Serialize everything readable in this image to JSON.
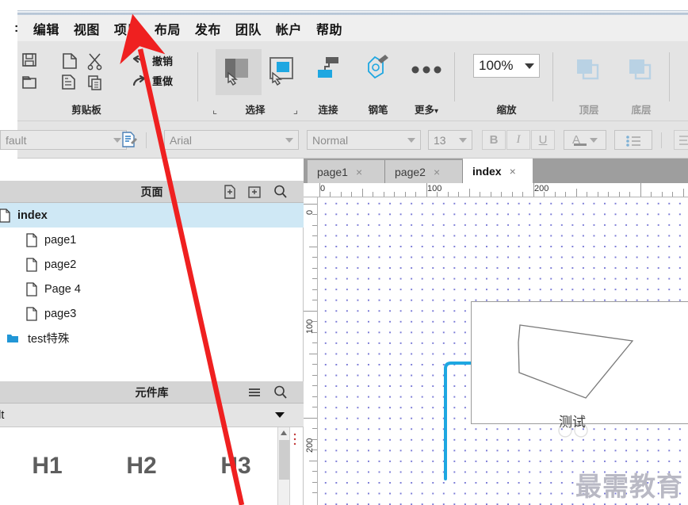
{
  "app": {
    "name": "Axure RP",
    "accent": "#1ea7e1",
    "annotation_color": "#ef2020"
  },
  "menubar": {
    "items": [
      {
        "label": ":",
        "name": "menu-file-clipped"
      },
      {
        "label": "编辑",
        "name": "menu-edit"
      },
      {
        "label": "视图",
        "name": "menu-view"
      },
      {
        "label": "项目",
        "name": "menu-project"
      },
      {
        "label": "布局",
        "name": "menu-layout"
      },
      {
        "label": "发布",
        "name": "menu-publish"
      },
      {
        "label": "团队",
        "name": "menu-team"
      },
      {
        "label": "帐户",
        "name": "menu-account"
      },
      {
        "label": "帮助",
        "name": "menu-help"
      }
    ]
  },
  "ribbon": {
    "clipboard_label": "剪贴板",
    "undo_label": "撤销",
    "redo_label": "重做",
    "select_label": "选择",
    "connect_label": "连接",
    "pen_label": "钢笔",
    "more_label": "更多",
    "more_caret": "▾",
    "zoom_label": "缩放",
    "zoom_value": "100%",
    "front_label": "顶层",
    "back_label": "底层"
  },
  "stylebar": {
    "style_value": "fault",
    "font_value": "Arial",
    "weight_value": "Normal",
    "size_value": "13",
    "bold_label": "B",
    "italic_label": "I",
    "underline_label": "U",
    "color_label": "A",
    "list_label": "≔"
  },
  "pages_panel": {
    "title": "页面",
    "add_page_icon": "add-page-icon",
    "add_folder_icon": "add-folder-icon",
    "search_icon": "search-icon",
    "items": [
      {
        "label": "index",
        "type": "page",
        "indent": 0,
        "selected": true
      },
      {
        "label": "page1",
        "type": "page",
        "indent": 1,
        "selected": false
      },
      {
        "label": "page2",
        "type": "page",
        "indent": 1,
        "selected": false
      },
      {
        "label": "Page 4",
        "type": "page",
        "indent": 1,
        "selected": false
      },
      {
        "label": "page3",
        "type": "page",
        "indent": 1,
        "selected": false
      },
      {
        "label": "test特殊",
        "type": "folder",
        "indent": 0,
        "selected": false
      }
    ]
  },
  "widgets_panel": {
    "title": "元件库",
    "menu_icon": "hamburger-icon",
    "search_icon": "search-icon",
    "library_value": "fault",
    "items": [
      {
        "label": "H1"
      },
      {
        "label": "H2"
      },
      {
        "label": "H3"
      }
    ]
  },
  "canvas": {
    "tabs": [
      {
        "label": "page1",
        "active": false,
        "close": "×"
      },
      {
        "label": "page2",
        "active": false,
        "close": "×"
      },
      {
        "label": "index",
        "active": true,
        "close": "×"
      }
    ],
    "ruler_h_labels": [
      "0",
      "100",
      "200"
    ],
    "ruler_v_labels": [
      "0",
      "100",
      "200"
    ],
    "shape_label": "测试",
    "watermark": "最需教育"
  }
}
